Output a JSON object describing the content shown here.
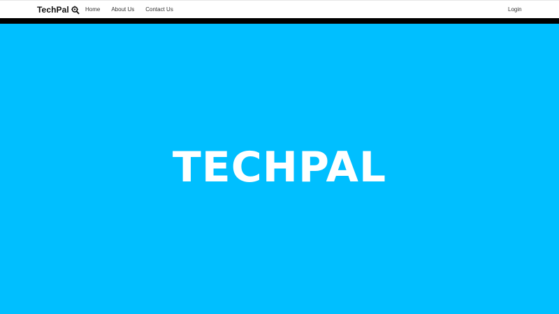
{
  "navbar": {
    "brand": "TechPal",
    "brand_icon": "magnifier-gear-icon",
    "links": [
      {
        "label": "Home"
      },
      {
        "label": "About Us"
      },
      {
        "label": "Contact Us"
      }
    ],
    "login_label": "Login"
  },
  "hero": {
    "title": "TECHPAL",
    "background_color": "#00bfff",
    "text_color": "#ffffff"
  },
  "colors": {
    "divider": "#000000",
    "navbar_bg": "#ffffff"
  }
}
